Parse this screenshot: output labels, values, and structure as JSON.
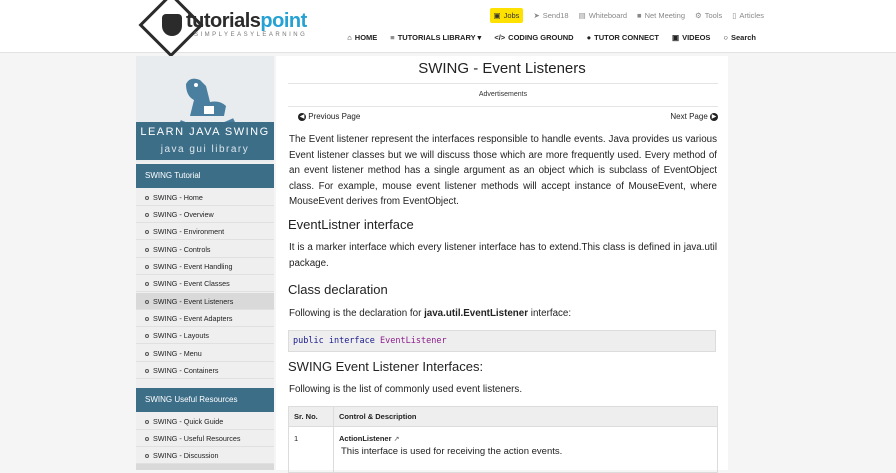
{
  "header": {
    "logo_a": "tutorials",
    "logo_b": "point",
    "logo_tagline": "SIMPLYEASYLEARNING",
    "top_links": [
      "Jobs",
      "Send18",
      "Whiteboard",
      "Net Meeting",
      "Tools",
      "Articles"
    ],
    "nav": [
      "HOME",
      "TUTORIALS LIBRARY ▾",
      "CODING GROUND",
      "TUTOR CONNECT",
      "VIDEOS",
      "Search"
    ]
  },
  "sidebar": {
    "banner_title": "LEARN JAVA SWING",
    "banner_sub": "java gui library",
    "tutorial_heading": "SWING Tutorial",
    "items": [
      "SWING - Home",
      "SWING - Overview",
      "SWING - Environment",
      "SWING - Controls",
      "SWING - Event Handling",
      "SWING - Event Classes",
      "SWING - Event Listeners",
      "SWING - Event Adapters",
      "SWING - Layouts",
      "SWING - Menu",
      "SWING - Containers"
    ],
    "resources_heading": "SWING Useful Resources",
    "resources": [
      "SWING - Quick Guide",
      "SWING - Useful Resources",
      "SWING - Discussion"
    ]
  },
  "content": {
    "title": "SWING - Event Listeners",
    "ads": "Advertisements",
    "prev": "Previous Page",
    "next": "Next Page",
    "intro": "The Event listener represent the interfaces responsible to handle events. Java provides us various Event listener classes but we will discuss those which are more frequently used. Every method of an event listener method has a single argument as an object which is subclass of EventObject class. For example, mouse event listener methods will accept instance of MouseEvent, where MouseEvent derives from EventObject.",
    "h_interface": "EventListner interface",
    "interface_text": "It is a marker interface which every listener interface has to extend.This class is defined in java.util package.",
    "h_decl": "Class declaration",
    "decl_prefix": "Following is the declaration for ",
    "decl_bold": "java.util.EventListener",
    "decl_suffix": " interface:",
    "code_kw1": "public",
    "code_kw2": "interface",
    "code_cls": "EventListener",
    "h_list": "SWING Event Listener Interfaces:",
    "list_text": "Following is the list of commonly used event listeners.",
    "table_headers": [
      "Sr. No.",
      "Control & Description"
    ],
    "rows": [
      {
        "no": "1",
        "name": "ActionListener",
        "desc": "This interface is used for receiving the action events."
      }
    ]
  }
}
